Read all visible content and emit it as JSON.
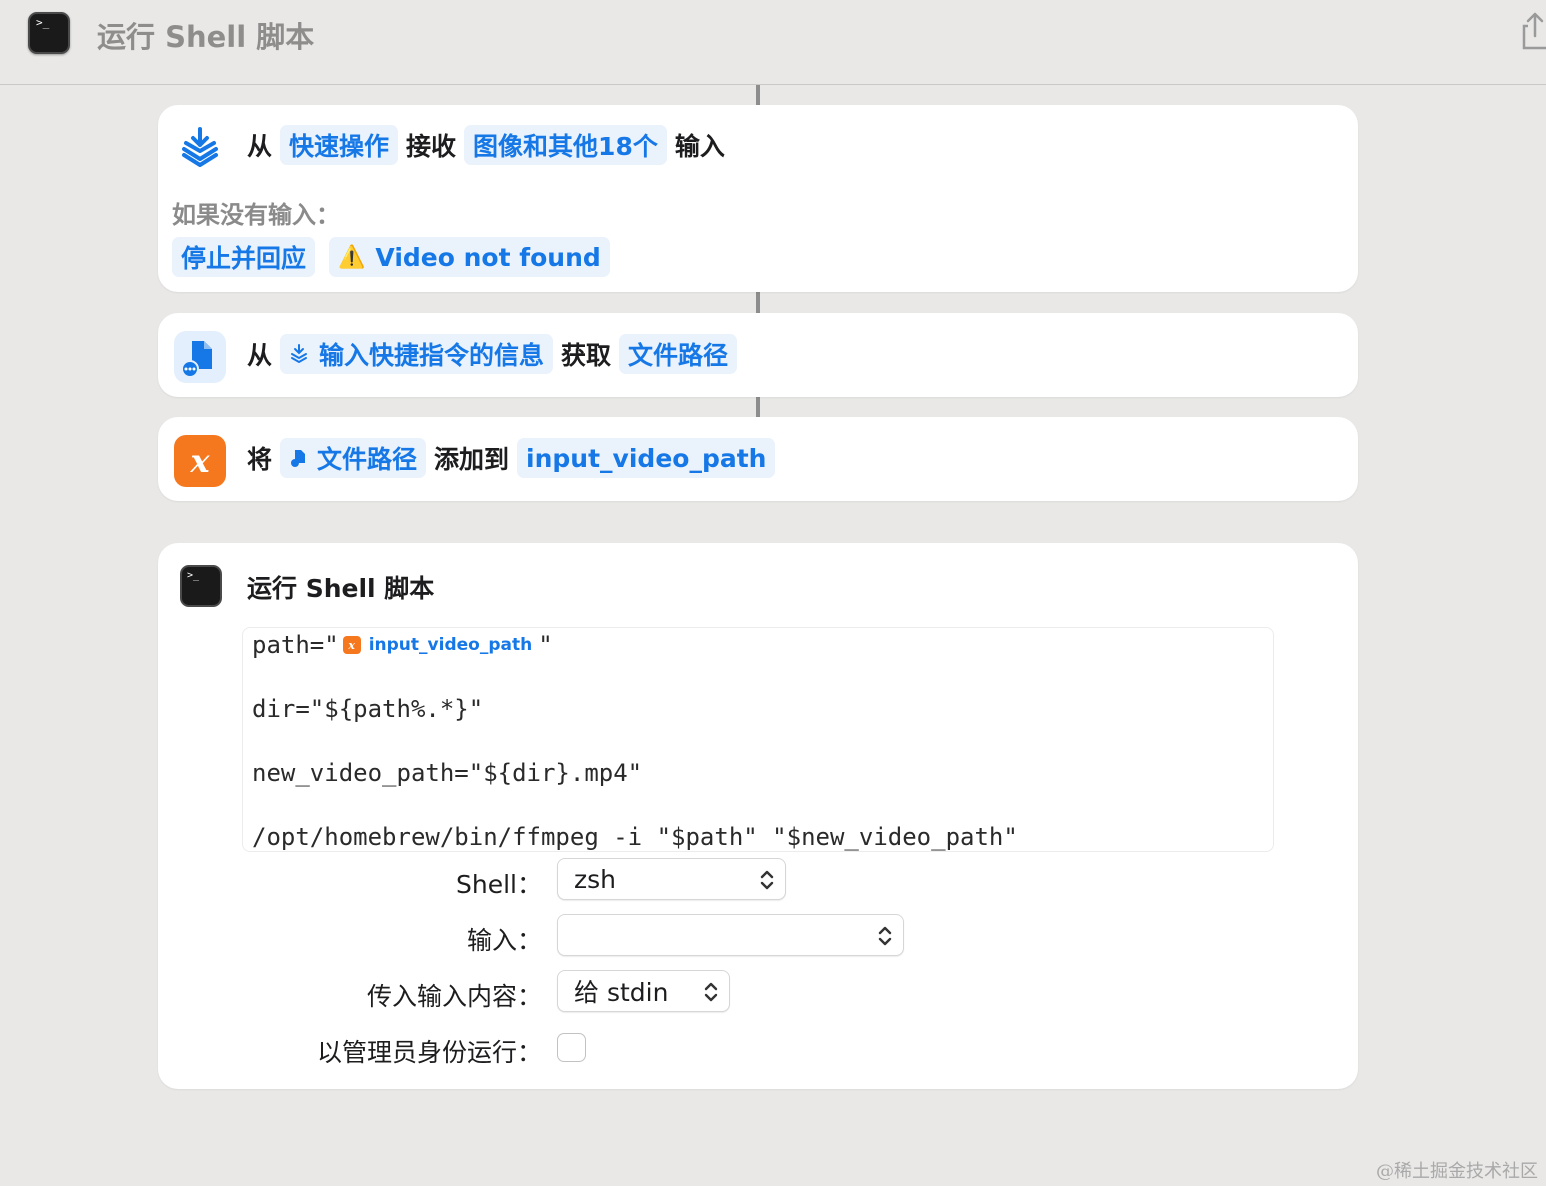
{
  "window": {
    "title": "运行 Shell 脚本",
    "app_icon": "terminal-icon",
    "share_icon": "share-icon"
  },
  "actions": [
    {
      "icon": "receive-input-icon",
      "words": [
        "从",
        "接收",
        "输入"
      ],
      "tokens": [
        "快速操作",
        "图像和其他18个"
      ],
      "no_input_label": "如果没有输入：",
      "no_input_action": "停止并回应",
      "no_input_message": "Video not found",
      "warning_icon": "⚠️"
    },
    {
      "icon": "get-file-details-icon",
      "words": [
        "从",
        "获取"
      ],
      "tokens": [
        "输入快捷指令的信息",
        "文件路径"
      ]
    },
    {
      "icon": "variable-x-icon",
      "icon_glyph": "x",
      "words": [
        "将",
        "添加到"
      ],
      "tokens": [
        "文件路径",
        "input_video_path"
      ]
    }
  ],
  "shell": {
    "title": "运行 Shell 脚本",
    "code": {
      "line1_prefix": "path=\"",
      "line1_variable": "input_video_path",
      "line1_suffix": "\"",
      "line2": "dir=\"${path%.*}\"",
      "line3": "new_video_path=\"${dir}.mp4\"",
      "line4": "/opt/homebrew/bin/ffmpeg -i \"$path\" \"$new_video_path\""
    },
    "fields": {
      "shell_label": "Shell：",
      "shell_value": "zsh",
      "input_label": "输入：",
      "input_value": "",
      "pass_input_label": "传入输入内容：",
      "pass_input_value": "给 stdin",
      "admin_label": "以管理员身份运行：",
      "admin_checked": false
    }
  },
  "watermark": "@稀土掘金技术社区",
  "colors": {
    "accent": "#1678e6",
    "token_bg": "#eaf2fc",
    "variable_orange": "#f5781f",
    "background": "#e9e8e7"
  }
}
